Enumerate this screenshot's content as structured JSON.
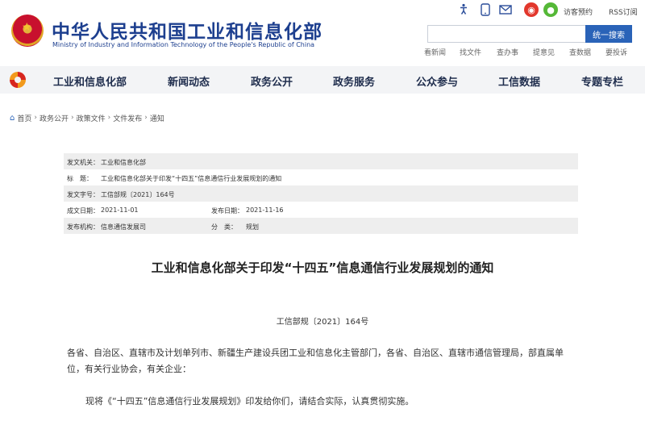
{
  "header": {
    "site_title": "中华人民共和国工业和信息化部",
    "site_subtitle": "Ministry of Industry and Information Technology of the People's Republic of China",
    "top_icons": [
      "accessibility-icon",
      "mobile-icon",
      "mail-icon",
      "weibo-icon",
      "wechat-icon"
    ],
    "visitor_reservation": "访客预约",
    "rss": "RSS订阅",
    "search": {
      "placeholder": "",
      "button": "统一搜索"
    },
    "quick_links": [
      "看新闻",
      "找文件",
      "查办事",
      "提意见",
      "查数据",
      "要投诉"
    ]
  },
  "nav": {
    "items": [
      "工业和信息化部",
      "新闻动态",
      "政务公开",
      "政务服务",
      "公众参与",
      "工信数据",
      "专题专栏"
    ]
  },
  "breadcrumb": [
    "首页",
    "政务公开",
    "政策文件",
    "文件发布",
    "通知"
  ],
  "meta": {
    "issuer_label": "发文机关：",
    "issuer": "工业和信息化部",
    "title_label": "标　题：",
    "title": "工业和信息化部关于印发“十四五”信息通信行业发展规划的通知",
    "doc_no_label": "发文字号：",
    "doc_no": "工信部规〔2021〕164号",
    "date_label": "成文日期：",
    "date": "2021-11-01",
    "publish_label": "发布日期：",
    "publish": "2021-11-16",
    "org_label": "发布机构：",
    "org": "信息通信发展司",
    "category_label": "分　类：",
    "category": "规划"
  },
  "document": {
    "title": "工业和信息化部关于印发“十四五”信息通信行业发展规划的通知",
    "number": "工信部规〔2021〕164号",
    "para1": "各省、自治区、直辖市及计划单列市、新疆生产建设兵团工业和信息化主管部门，各省、自治区、直辖市通信管理局，部直属单位，有关行业协会，有关企业：",
    "para2": "现将《“十四五”信息通信行业发展规划》印发给你们，请结合实际，认真贯彻实施。"
  }
}
